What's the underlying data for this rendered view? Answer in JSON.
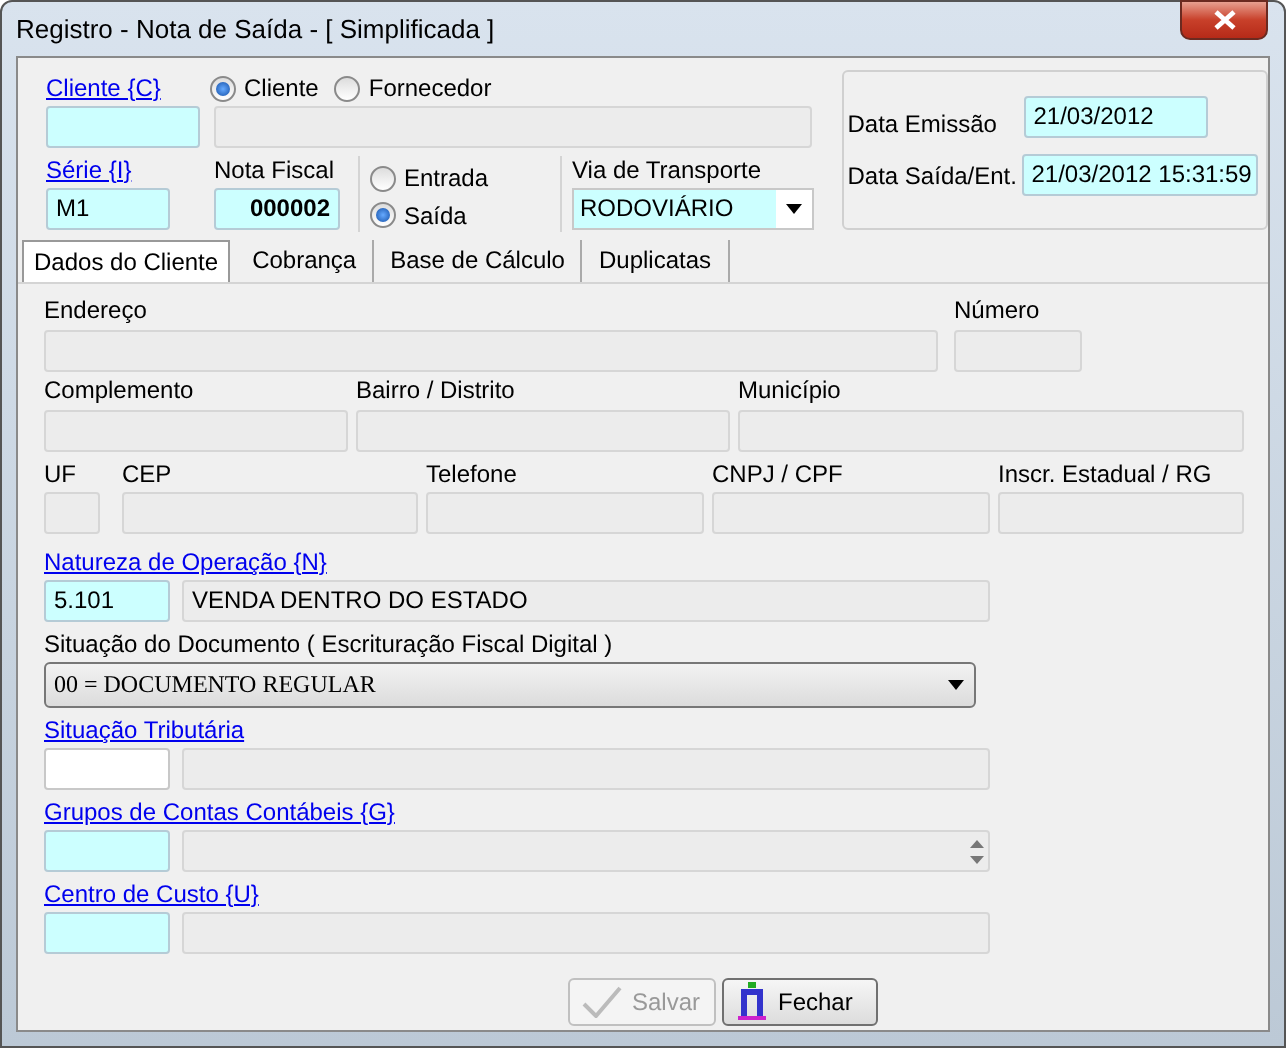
{
  "window": {
    "title": "Registro - Nota de Saída - [ Simplificada ]"
  },
  "header": {
    "cliente": {
      "label": "Cliente {C}"
    },
    "party_type": [
      {
        "label": "Cliente",
        "selected": true
      },
      {
        "label": "Fornecedor",
        "selected": false
      }
    ],
    "serie": {
      "label": "Série {I}",
      "value": "M1"
    },
    "nota_fiscal": {
      "label": "Nota Fiscal",
      "value": "000002"
    },
    "direction": [
      {
        "label": "Entrada",
        "selected": false
      },
      {
        "label": "Saída",
        "selected": true
      }
    ],
    "transport": {
      "label": "Via de Transporte",
      "value": "RODOVIÁRIO"
    },
    "dates": [
      {
        "label": "Data Emissão",
        "value": "21/03/2012"
      },
      {
        "label": "Data Saída/Ent.",
        "value": "21/03/2012 15:31:59"
      }
    ]
  },
  "tabs": [
    {
      "label": "Dados do Cliente",
      "selected": true
    },
    {
      "label": "Cobrança",
      "selected": false
    },
    {
      "label": "Base de Cálculo",
      "selected": false
    },
    {
      "label": "Duplicatas",
      "selected": false
    }
  ],
  "address_rows": [
    [
      {
        "label": "Endereço"
      },
      {
        "label": "Número"
      }
    ],
    [
      {
        "label": "Complemento"
      },
      {
        "label": "Bairro / Distrito"
      },
      {
        "label": "Município"
      }
    ],
    [
      {
        "label": "UF"
      },
      {
        "label": "CEP"
      },
      {
        "label": "Telefone"
      },
      {
        "label": "CNPJ / CPF"
      },
      {
        "label": "Inscr. Estadual / RG"
      }
    ]
  ],
  "lookups": [
    {
      "kind": "lookup",
      "label": "Natureza de Operação {N}",
      "required": true,
      "code": "5.101",
      "description": "VENDA DENTRO DO ESTADO"
    },
    {
      "kind": "select",
      "label": "Situação do Documento ( Escrituração Fiscal Digital )",
      "value": "00 = DOCUMENTO REGULAR"
    },
    {
      "kind": "lookup",
      "label": "Situação Tributária",
      "required": false
    },
    {
      "kind": "spin",
      "label": "Grupos de Contas Contábeis {G}",
      "required": true
    },
    {
      "kind": "lookup",
      "label": "Centro de Custo {U}",
      "required": true
    }
  ],
  "buttons": [
    {
      "kind": "save",
      "label": "Salvar",
      "disabled": true
    },
    {
      "kind": "close",
      "label": "Fechar",
      "disabled": false
    }
  ]
}
